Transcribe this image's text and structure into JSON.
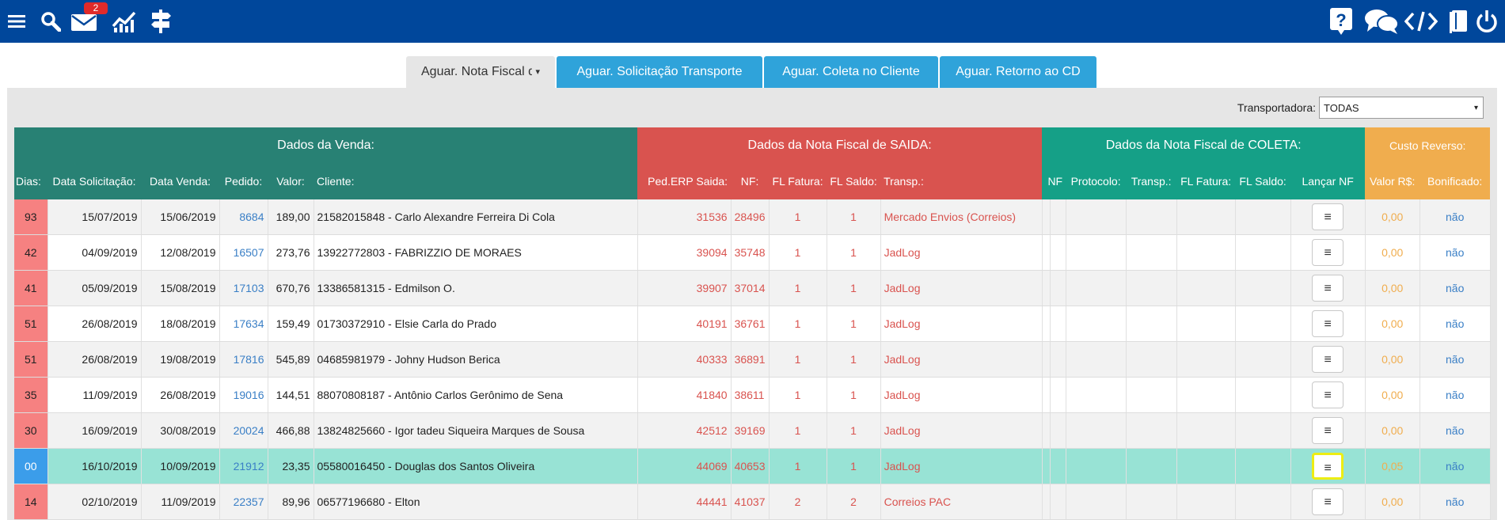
{
  "topbar": {
    "icons": [
      "menu-icon",
      "search-icon",
      "mail-icon",
      "chart-icon",
      "signpost-icon",
      "help-icon",
      "chat-icon",
      "code-icon",
      "book-icon",
      "power-icon"
    ],
    "mail_badge": "2",
    "color": "#00479b"
  },
  "tabs": [
    {
      "label": "Aguar. Nota Fiscal de Coleta",
      "caret": "▾",
      "active": true
    },
    {
      "label": "Aguar. Solicitação Transporte",
      "active": false
    },
    {
      "label": "Aguar. Coleta no Cliente",
      "active": false
    },
    {
      "label": "Aguar. Retorno ao CD",
      "active": false
    }
  ],
  "filter": {
    "label": "Transportadora:",
    "value": "TODAS",
    "arrow": "▾"
  },
  "groups": {
    "venda": "Dados da Venda:",
    "saida": "Dados da Nota Fiscal de SAIDA:",
    "coleta": "Dados da Nota Fiscal de COLETA:",
    "custo": "Custo Reverso:"
  },
  "columns": {
    "dias": "Dias:",
    "data_solicitacao": "Data Solicitação:",
    "data_venda": "Data Venda:",
    "pedido": "Pedido:",
    "valor": "Valor:",
    "cliente": "Cliente:",
    "ped_erp": "Ped.ERP Saida:",
    "nf": "NF:",
    "fl_fatura": "FL Fatura:",
    "fl_saldo": "FL Saldo:",
    "transp": "Transp.:",
    "c_nf": "NF",
    "c_protocolo": "Protocolo:",
    "c_transp": "Transp.:",
    "c_fl_fatura": "FL Fatura:",
    "c_fl_saldo": "FL Saldo:",
    "lancar_nf": "Lançar NF",
    "valor_rs": "Valor R$:",
    "bonificado": "Bonificado:"
  },
  "rows": [
    {
      "dias": "93",
      "data_solicitacao": "15/07/2019",
      "data_venda": "15/06/2019",
      "pedido": "8684",
      "valor": "189,00",
      "cliente": "21582015848 - Carlo Alexandre Ferreira Di Cola",
      "ped_erp": "31536",
      "nf": "28496",
      "fl_fatura": "1",
      "fl_saldo": "1",
      "transp": "Mercado Envios (Correios)",
      "valor_rs": "0,00",
      "bonificado": "não"
    },
    {
      "dias": "42",
      "data_solicitacao": "04/09/2019",
      "data_venda": "12/08/2019",
      "pedido": "16507",
      "valor": "273,76",
      "cliente": "13922772803 - FABRIZZIO DE MORAES",
      "ped_erp": "39094",
      "nf": "35748",
      "fl_fatura": "1",
      "fl_saldo": "1",
      "transp": "JadLog",
      "valor_rs": "0,00",
      "bonificado": "não"
    },
    {
      "dias": "41",
      "data_solicitacao": "05/09/2019",
      "data_venda": "15/08/2019",
      "pedido": "17103",
      "valor": "670,76",
      "cliente": "13386581315 - Edmilson O.",
      "ped_erp": "39907",
      "nf": "37014",
      "fl_fatura": "1",
      "fl_saldo": "1",
      "transp": "JadLog",
      "valor_rs": "0,00",
      "bonificado": "não"
    },
    {
      "dias": "51",
      "data_solicitacao": "26/08/2019",
      "data_venda": "18/08/2019",
      "pedido": "17634",
      "valor": "159,49",
      "cliente": "01730372910 - Elsie Carla do Prado",
      "ped_erp": "40191",
      "nf": "36761",
      "fl_fatura": "1",
      "fl_saldo": "1",
      "transp": "JadLog",
      "valor_rs": "0,00",
      "bonificado": "não"
    },
    {
      "dias": "51",
      "data_solicitacao": "26/08/2019",
      "data_venda": "19/08/2019",
      "pedido": "17816",
      "valor": "545,89",
      "cliente": "04685981979 - Johny Hudson Berica",
      "ped_erp": "40333",
      "nf": "36891",
      "fl_fatura": "1",
      "fl_saldo": "1",
      "transp": "JadLog",
      "valor_rs": "0,00",
      "bonificado": "não"
    },
    {
      "dias": "35",
      "data_solicitacao": "11/09/2019",
      "data_venda": "26/08/2019",
      "pedido": "19016",
      "valor": "144,51",
      "cliente": "88070808187 - Antônio Carlos Gerônimo de Sena",
      "ped_erp": "41840",
      "nf": "38611",
      "fl_fatura": "1",
      "fl_saldo": "1",
      "transp": "JadLog",
      "valor_rs": "0,00",
      "bonificado": "não"
    },
    {
      "dias": "30",
      "data_solicitacao": "16/09/2019",
      "data_venda": "30/08/2019",
      "pedido": "20024",
      "valor": "466,88",
      "cliente": "13824825660 - Igor tadeu Siqueira Marques de Sousa",
      "ped_erp": "42512",
      "nf": "39169",
      "fl_fatura": "1",
      "fl_saldo": "1",
      "transp": "JadLog",
      "valor_rs": "0,00",
      "bonificado": "não"
    },
    {
      "dias": "00",
      "data_solicitacao": "16/10/2019",
      "data_venda": "10/09/2019",
      "pedido": "21912",
      "valor": "23,35",
      "cliente": "05580016450 - Douglas dos Santos Oliveira",
      "ped_erp": "44069",
      "nf": "40653",
      "fl_fatura": "1",
      "fl_saldo": "1",
      "transp": "JadLog",
      "valor_rs": "0,05",
      "bonificado": "não",
      "selected": true
    },
    {
      "dias": "14",
      "data_solicitacao": "02/10/2019",
      "data_venda": "11/09/2019",
      "pedido": "22357",
      "valor": "89,96",
      "cliente": "06577196680 - Elton",
      "ped_erp": "44441",
      "nf": "41037",
      "fl_fatura": "2",
      "fl_saldo": "2",
      "transp": "Correios PAC",
      "valor_rs": "0,00",
      "bonificado": "não"
    }
  ],
  "menu_glyph": "≡"
}
